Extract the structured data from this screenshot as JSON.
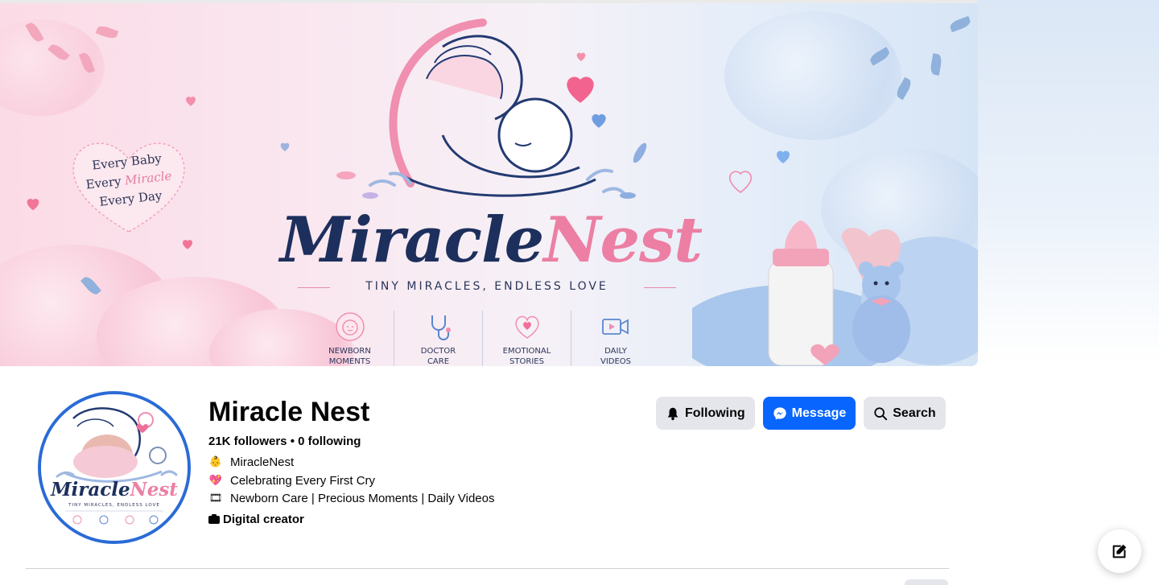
{
  "cover": {
    "badge_lines": [
      "Every Baby",
      "Every",
      "Miracle",
      "Every Day"
    ],
    "brand_word1": "Miracle",
    "brand_word2": "Nest",
    "tagline": "TINY MIRACLES, ENDLESS LOVE",
    "features": [
      {
        "line1": "NEWBORN",
        "line2": "MOMENTS",
        "icon": "baby-face-icon"
      },
      {
        "line1": "DOCTOR",
        "line2": "CARE",
        "icon": "stethoscope-icon"
      },
      {
        "line1": "EMOTIONAL",
        "line2": "STORIES",
        "icon": "heart-chat-icon"
      },
      {
        "line1": "DAILY",
        "line2": "VIDEOS",
        "icon": "video-camera-icon"
      }
    ]
  },
  "avatar": {
    "word1": "Miracle",
    "word2": "Nest",
    "tagline": "TINY MIRACLES, ENDLESS LOVE"
  },
  "profile": {
    "name": "Miracle Nest",
    "stats": "21K followers • 0 following",
    "intro": [
      {
        "emoji": "👶",
        "text": "MiracleNest"
      },
      {
        "emoji": "💖",
        "text": "Celebrating Every First Cry"
      },
      {
        "emoji": "🎞",
        "text": "Newborn Care | Precious Moments | Daily Videos"
      }
    ],
    "category": "Digital creator"
  },
  "actions": {
    "following_label": "Following",
    "message_label": "Message",
    "search_label": "Search"
  },
  "colors": {
    "accent_blue": "#0866ff",
    "button_gray": "#e4e6eb",
    "avatar_ring": "#2a6bd6",
    "brand_navy": "#1d2f5c",
    "brand_pink": "#ec7fa3"
  }
}
